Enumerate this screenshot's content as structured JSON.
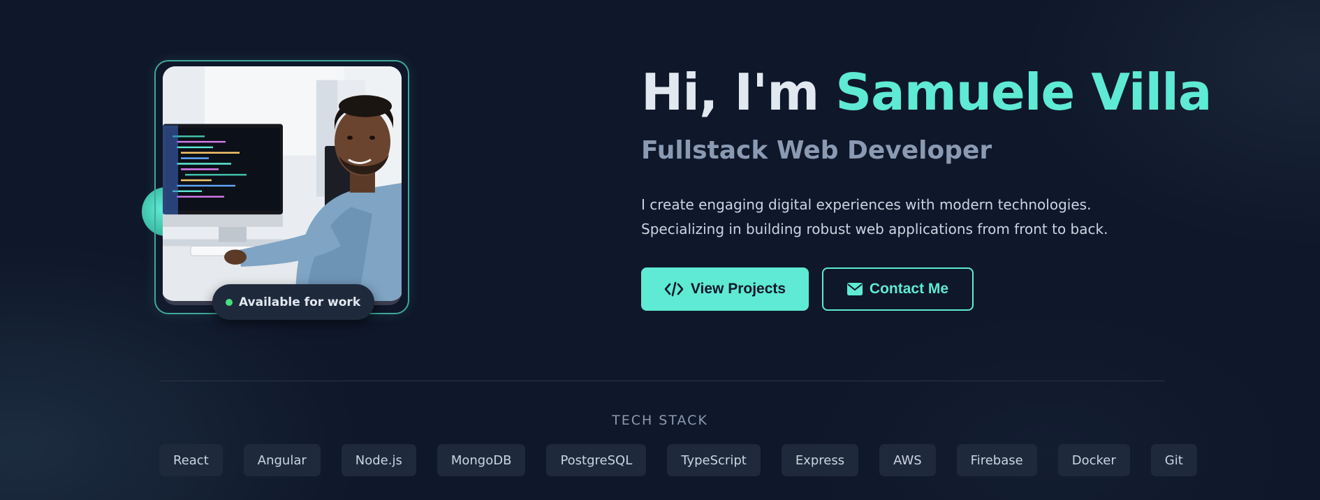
{
  "profile": {
    "image_alt": "Developer smiling at desk with code on monitor",
    "badge_label": "Available for work"
  },
  "hero": {
    "title_prefix": "Hi, I'm ",
    "name": "Samuele Villa",
    "subtitle": "Fullstack Web Developer",
    "description": "I create engaging digital experiences with modern technologies. Specializing in building robust web applications from front to back."
  },
  "buttons": {
    "primary_label": "View Projects",
    "primary_icon": "code-icon",
    "secondary_label": "Contact Me",
    "secondary_icon": "envelope-icon"
  },
  "tech_stack": {
    "heading": "TECH STACK",
    "items": [
      "React",
      "Angular",
      "Node.js",
      "MongoDB",
      "PostgreSQL",
      "TypeScript",
      "Express",
      "AWS",
      "Firebase",
      "Docker",
      "Git"
    ]
  },
  "colors": {
    "background": "#0f172a",
    "accent": "#5eead4",
    "chip_background": "#1e293b",
    "status_dot": "#4ade80"
  }
}
